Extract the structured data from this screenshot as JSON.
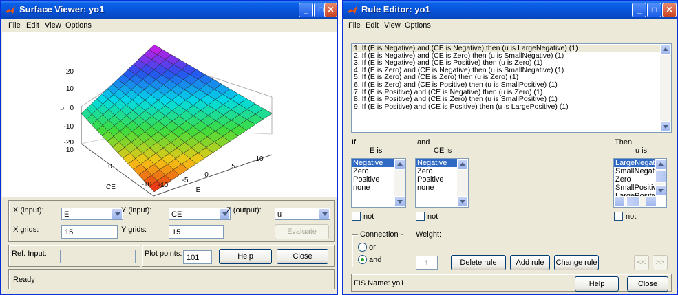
{
  "surface": {
    "title": "Surface Viewer: yo1",
    "menu": [
      "File",
      "Edit",
      "View",
      "Options"
    ],
    "plot": {
      "zlabel": "u",
      "xlabel": "E",
      "ylabel": "CE",
      "zticks": [
        "20",
        "10",
        "0",
        "-10",
        "-20"
      ],
      "xticks": [
        "10",
        "5",
        "0",
        "-5",
        "-10"
      ],
      "yticks": [
        "10",
        "0",
        "-10"
      ]
    },
    "x_input_label": "X (input):",
    "x_input_value": "E",
    "y_input_label": "Y (input):",
    "y_input_value": "CE",
    "z_output_label": "Z (output):",
    "z_output_value": "u",
    "x_grids_label": "X grids:",
    "x_grids_value": "15",
    "y_grids_label": "Y grids:",
    "y_grids_value": "15",
    "evaluate_label": "Evaluate",
    "ref_input_label": "Ref. Input:",
    "plot_points_label": "Plot points:",
    "plot_points_value": "101",
    "help_label": "Help",
    "close_label": "Close",
    "status": "Ready"
  },
  "rules": {
    "title": "Rule Editor: yo1",
    "menu": [
      "File",
      "Edit",
      "View",
      "Options"
    ],
    "list": [
      "1. If (E is Negative) and (CE is Negative) then (u is LargeNegative) (1)",
      "2. If (E is Negative) and (CE is Zero) then (u is SmallNegative) (1)",
      "3. If (E is Negative) and (CE is Positive) then (u is Zero) (1)",
      "4. If (E is Zero) and (CE is Negative) then (u is SmallNegative) (1)",
      "5. If (E is Zero) and (CE is Zero) then (u is Zero) (1)",
      "6. If (E is Zero) and (CE is Positive) then (u is SmallPositive) (1)",
      "7. If (E is Positive) and (CE is Negative) then (u is Zero) (1)",
      "8. If (E is Positive) and (CE is Zero) then (u is SmallPositive) (1)",
      "9. If (E is Positive) and (CE is Positive) then (u is LargePositive) (1)"
    ],
    "if_label": "If",
    "and_label": "and",
    "then_label": "Then",
    "e_label": "E is",
    "ce_label": "CE is",
    "u_label": "u is",
    "e_options": [
      "Negative",
      "Zero",
      "Positive",
      "none"
    ],
    "ce_options": [
      "Negative",
      "Zero",
      "Positive",
      "none"
    ],
    "u_options": [
      "LargeNegative",
      "SmallNegative",
      "Zero",
      "SmallPositive",
      "LargePositive"
    ],
    "not_label": "not",
    "connection_label": "Connection",
    "or_label": "or",
    "and_radio_label": "and",
    "weight_label": "Weight:",
    "weight_value": "1",
    "delete_label": "Delete rule",
    "add_label": "Add rule",
    "change_label": "Change rule",
    "prev_label": "<<",
    "next_label": ">>",
    "fis_name": "FIS Name: yo1",
    "help_label": "Help",
    "close_label": "Close"
  }
}
